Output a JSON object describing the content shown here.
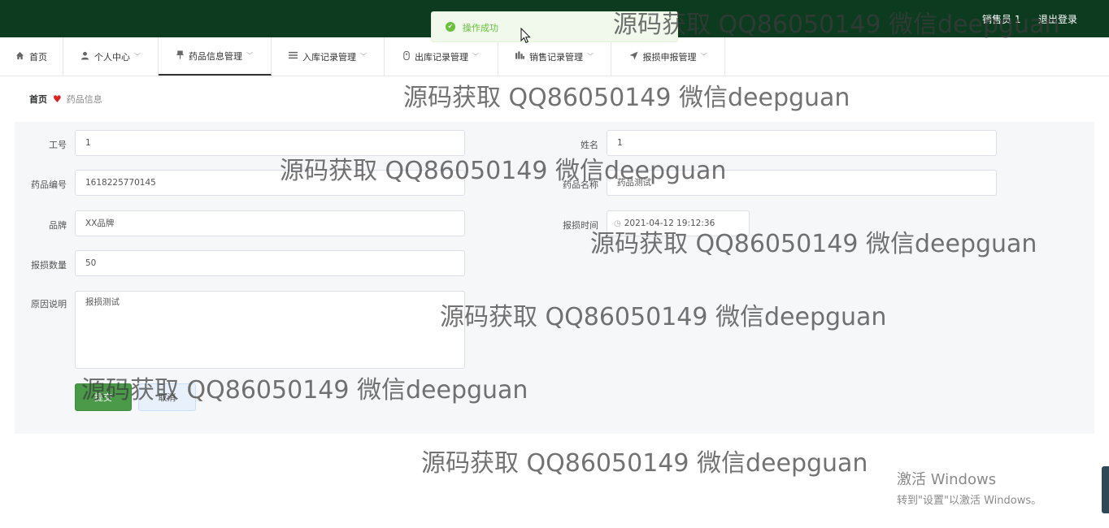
{
  "header": {
    "user_label": "销售员 1",
    "logout_label": "退出登录"
  },
  "toast": {
    "message": "操作成功"
  },
  "nav": {
    "items": [
      {
        "label": "首页",
        "icon": "home-icon"
      },
      {
        "label": "个人中心",
        "icon": "user-icon"
      },
      {
        "label": "药品信息管理",
        "icon": "pin-icon"
      },
      {
        "label": "入库记录管理",
        "icon": "list-icon"
      },
      {
        "label": "出库记录管理",
        "icon": "tag-icon"
      },
      {
        "label": "销售记录管理",
        "icon": "bar-chart-icon"
      },
      {
        "label": "报损申报管理",
        "icon": "send-icon"
      }
    ],
    "active_index": 2
  },
  "breadcrumb": {
    "home": "首页",
    "current": "药品信息"
  },
  "form": {
    "employee_id": {
      "label": "工号",
      "value": "1"
    },
    "name": {
      "label": "姓名",
      "value": "1"
    },
    "drug_code": {
      "label": "药品编号",
      "value": "1618225770145"
    },
    "drug_name": {
      "label": "药品名称",
      "value": "药品测试"
    },
    "brand": {
      "label": "品牌",
      "value": "XX品牌"
    },
    "report_time": {
      "label": "报损时间",
      "value": "2021-04-12 19:12:36"
    },
    "loss_quantity": {
      "label": "报损数量",
      "value": "50"
    },
    "reason": {
      "label": "原因说明",
      "value": "报损测试"
    },
    "submit_label": "提交",
    "cancel_label": "取消"
  },
  "watermark": "源码获取 QQ86050149 微信deepguan",
  "activation": {
    "title": "激活 Windows",
    "subtitle": "转到\"设置\"以激活 Windows。"
  },
  "colors": {
    "header_bg": "#0d3b20",
    "primary": "#4a9a4a",
    "success": "#67c23a",
    "heart": "#e02020"
  }
}
